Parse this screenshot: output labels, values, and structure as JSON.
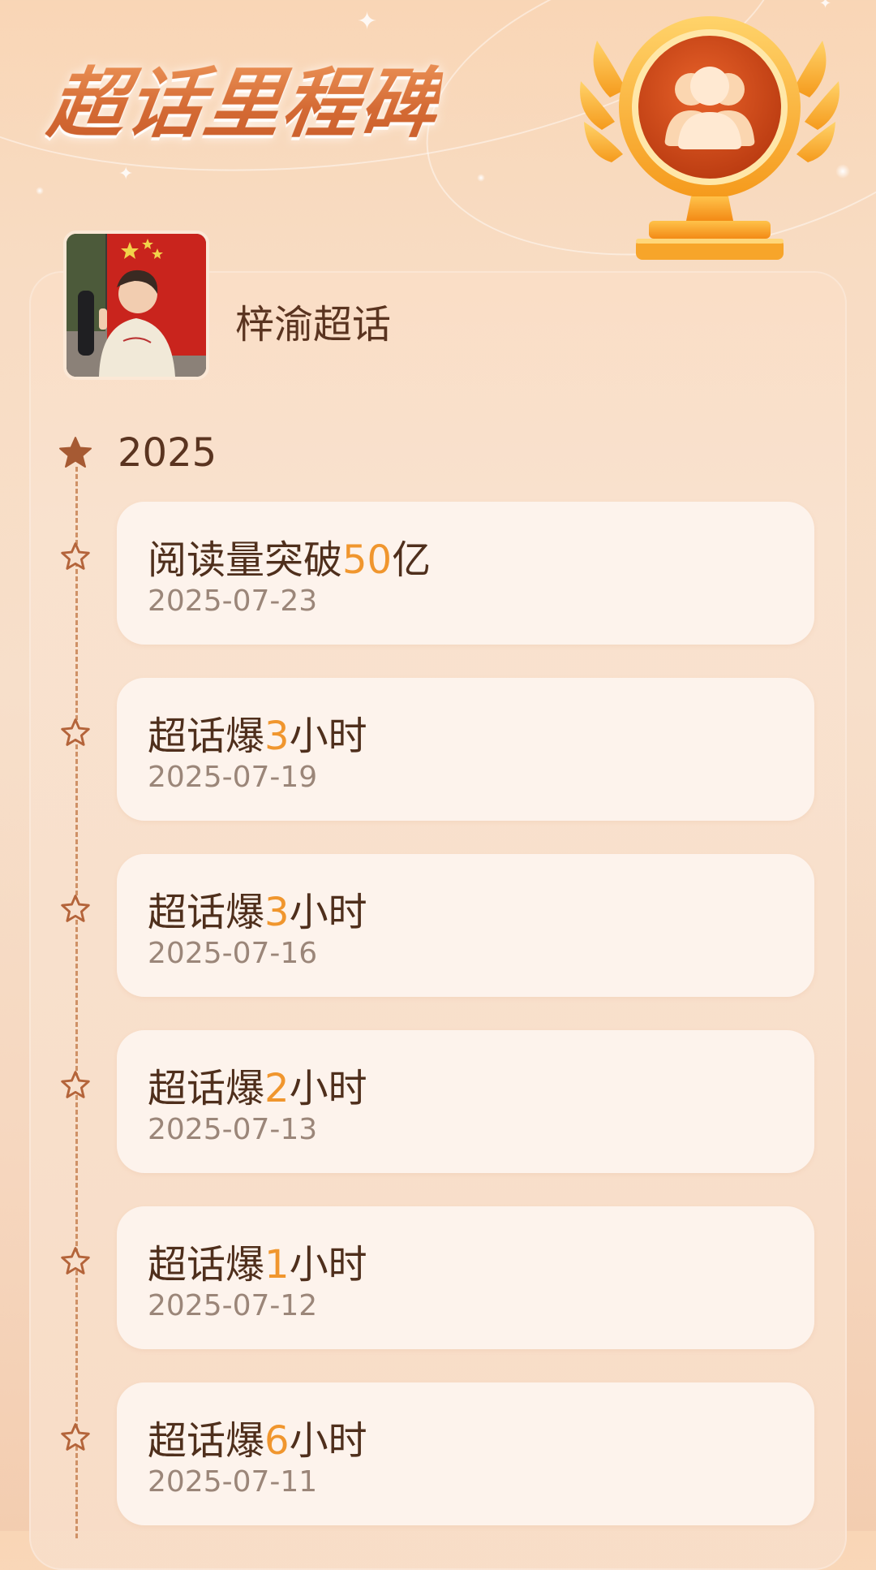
{
  "header": {
    "title": "超话里程碑",
    "trophy_icon": "trophy-icon"
  },
  "topic": {
    "name": "梓渝超话"
  },
  "timeline": {
    "year": "2025",
    "items": [
      {
        "prefix": "阅读量突破",
        "number": "50",
        "suffix": "亿",
        "date": "2025-07-23"
      },
      {
        "prefix": "超话爆",
        "number": "3",
        "suffix": "小时",
        "date": "2025-07-19"
      },
      {
        "prefix": "超话爆",
        "number": "3",
        "suffix": "小时",
        "date": "2025-07-16"
      },
      {
        "prefix": "超话爆",
        "number": "2",
        "suffix": "小时",
        "date": "2025-07-13"
      },
      {
        "prefix": "超话爆",
        "number": "1",
        "suffix": "小时",
        "date": "2025-07-12"
      },
      {
        "prefix": "超话爆",
        "number": "6",
        "suffix": "小时",
        "date": "2025-07-11"
      }
    ]
  },
  "colors": {
    "accent_number": "#f0962e",
    "title_orange": "#d46a34",
    "card_bg": "#fdf3ec",
    "timeline": "#cf9166"
  }
}
